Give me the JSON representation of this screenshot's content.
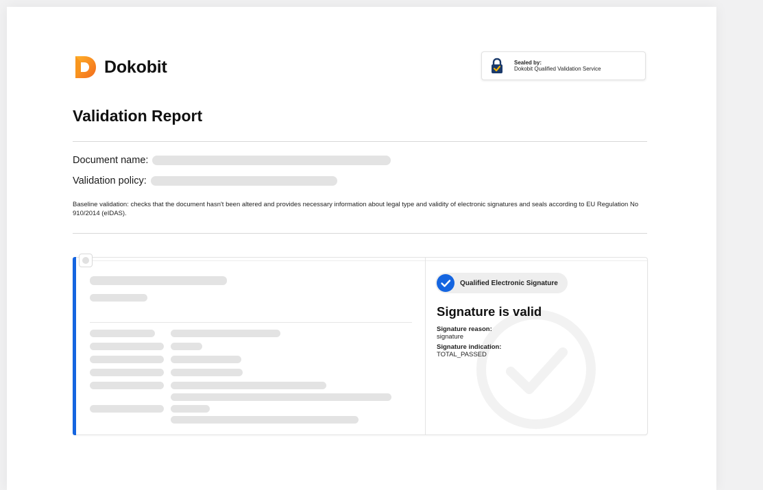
{
  "brand": {
    "name": "Dokobit"
  },
  "seal": {
    "label": "Sealed by:",
    "service": "Dokobit Qualified Validation Service"
  },
  "report": {
    "title": "Validation Report",
    "document_name_label": "Document name:",
    "validation_policy_label": "Validation policy:",
    "description": "Baseline validation: checks that the document hasn't been altered and provides necessary information about legal type and validity of electronic signatures and seals according to EU Regulation No 910/2014 (eIDAS)."
  },
  "signature": {
    "badge": "Qualified Electronic Signature",
    "status": "Signature is valid",
    "reason_label": "Signature reason:",
    "reason_value": "signature",
    "indication_label": "Signature indication:",
    "indication_value": "TOTAL_PASSED"
  },
  "colors": {
    "brand_orange": "#f7941d",
    "accent_blue": "#1565e0",
    "skeleton": "#e3e3e3"
  },
  "icons": {
    "logo": "dokobit-d-logo",
    "seal": "lock-check-icon",
    "badge": "check-circle-icon",
    "watermark": "check-watermark-icon"
  }
}
